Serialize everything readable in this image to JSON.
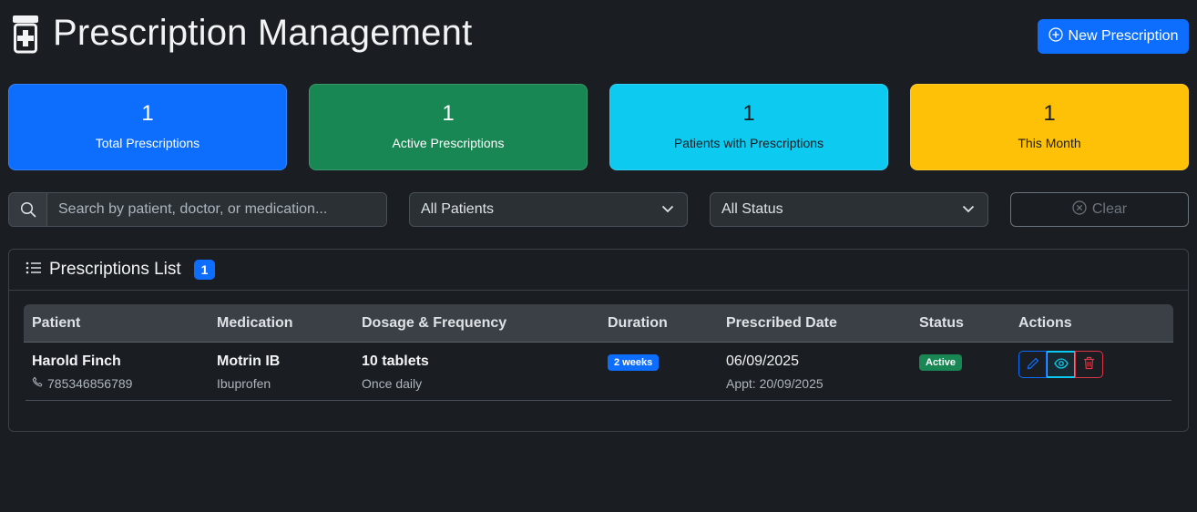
{
  "header": {
    "title": "Prescription Management",
    "icon": "prescription-bottle-icon",
    "new_button_label": "New Prescription"
  },
  "stats": [
    {
      "value": "1",
      "label": "Total Prescriptions",
      "color": "#0d6efd"
    },
    {
      "value": "1",
      "label": "Active Prescriptions",
      "color": "#198754"
    },
    {
      "value": "1",
      "label": "Patients with Prescriptions",
      "color": "#0dcaf0"
    },
    {
      "value": "1",
      "label": "This Month",
      "color": "#ffc107"
    }
  ],
  "filters": {
    "search_placeholder": "Search by patient, doctor, or medication...",
    "patient_select": "All Patients",
    "status_select": "All Status",
    "clear_label": "Clear"
  },
  "list": {
    "title": "Prescriptions List",
    "count": "1",
    "columns": [
      "Patient",
      "Medication",
      "Dosage & Frequency",
      "Duration",
      "Prescribed Date",
      "Status",
      "Actions"
    ],
    "rows": [
      {
        "patient_name": "Harold Finch",
        "patient_phone": "785346856789",
        "medication": "Motrin IB",
        "generic": "Ibuprofen",
        "dosage": "10 tablets",
        "frequency": "Once daily",
        "duration": "2 weeks",
        "prescribed_date": "06/09/2025",
        "appointment": "Appt: 20/09/2025",
        "status": "Active"
      }
    ]
  }
}
